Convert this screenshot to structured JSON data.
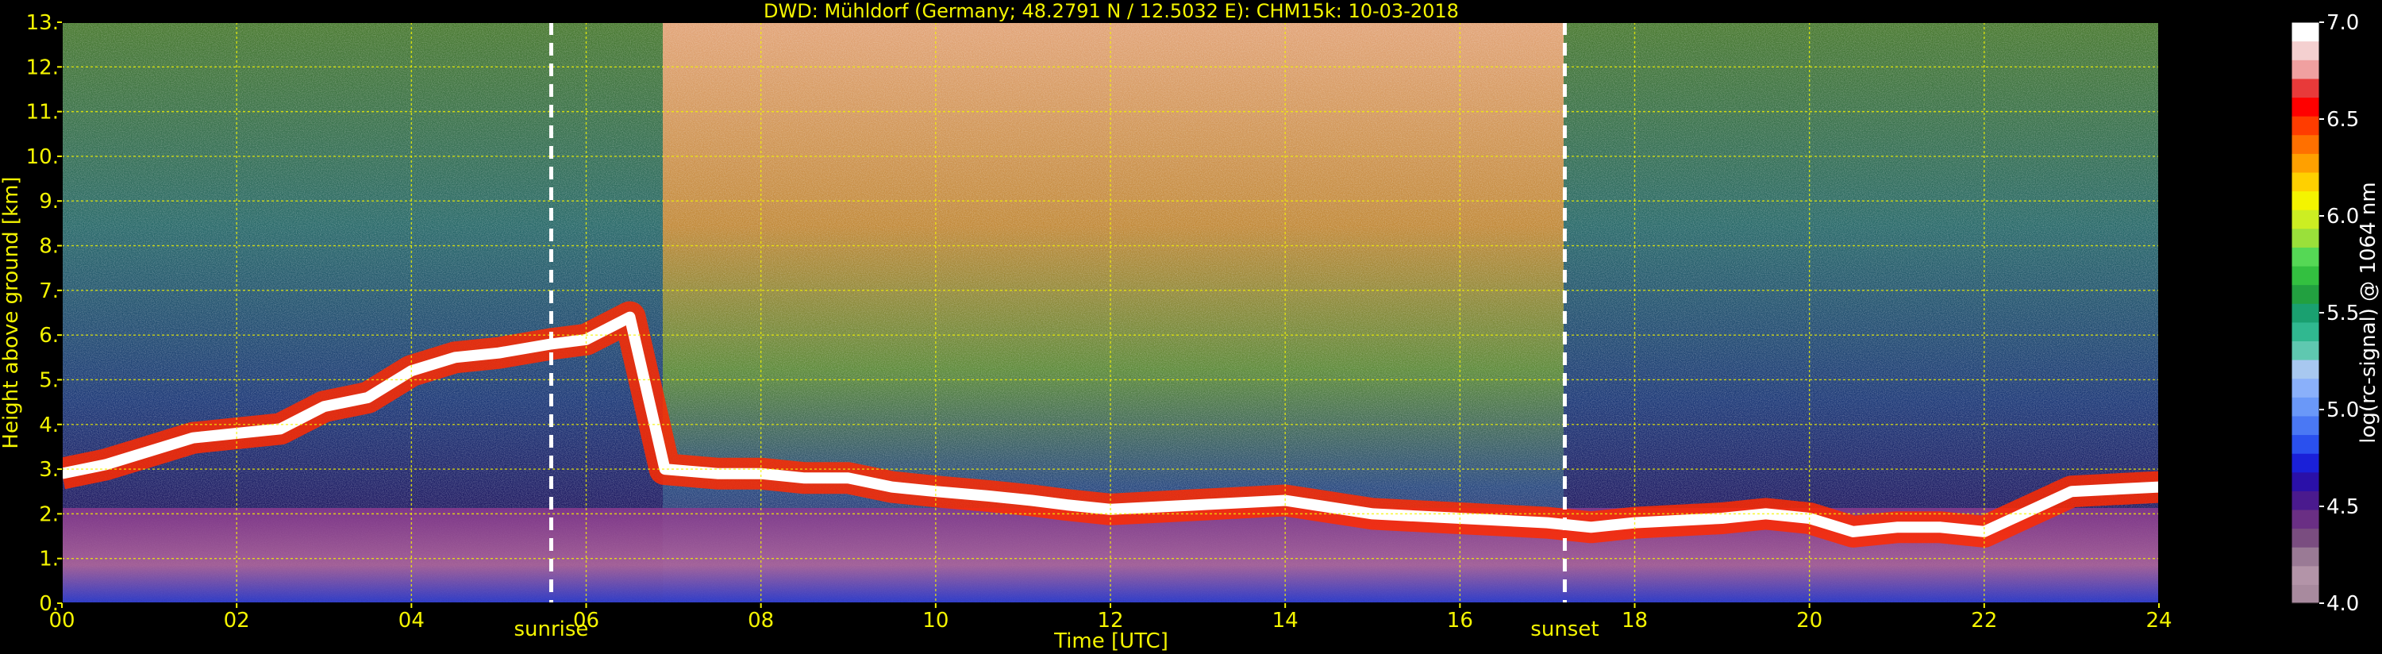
{
  "chart_data": {
    "type": "heatmap",
    "title": "DWD: Mühldorf (Germany; 48.2791 N / 12.5032 E):    CHM15k: 10-03-2018",
    "xlabel": "Time [UTC]",
    "ylabel": "Height above ground [km]",
    "xlim": [
      0,
      24
    ],
    "ylim": [
      0,
      13
    ],
    "x_ticks": [
      "00",
      "02",
      "04",
      "06",
      "08",
      "10",
      "12",
      "14",
      "16",
      "18",
      "20",
      "22",
      "24"
    ],
    "y_ticks": [
      "0.",
      "1.",
      "2.",
      "3.",
      "4.",
      "5.",
      "6.",
      "7.",
      "8.",
      "9.",
      "10.",
      "11.",
      "12.",
      "13."
    ],
    "grid": true,
    "annotations": [
      {
        "label": "sunrise",
        "x": 5.6
      },
      {
        "label": "sunset",
        "x": 17.2
      }
    ],
    "colorbar": {
      "label": "log(rc-signal) @ 1064 nm",
      "range": [
        4.0,
        7.0
      ],
      "ticks": [
        "4.0",
        "4.5",
        "5.0",
        "5.5",
        "6.0",
        "6.5",
        "7.0"
      ],
      "colors": [
        "#a88a9e",
        "#b394a8",
        "#9a7a95",
        "#7a4d80",
        "#6a2f84",
        "#4a1a8e",
        "#2a10a8",
        "#1a20d8",
        "#2a50ee",
        "#4a78f4",
        "#6a98f8",
        "#8ab0fa",
        "#a8c8f0",
        "#5fc8b0",
        "#30b890",
        "#1aa070",
        "#22a040",
        "#33c040",
        "#55d855",
        "#9ae03a",
        "#ccee22",
        "#f4f400",
        "#ffd000",
        "#ffa000",
        "#ff7000",
        "#ff3c00",
        "#ff0000",
        "#e83a3a",
        "#f0a0a0",
        "#f4d0d0",
        "#ffffff"
      ]
    },
    "layers": [
      {
        "name": "cloud base",
        "points": [
          [
            0,
            2.9
          ],
          [
            0.5,
            3.1
          ],
          [
            1.0,
            3.4
          ],
          [
            1.5,
            3.7
          ],
          [
            2.0,
            3.8
          ],
          [
            2.5,
            3.9
          ],
          [
            3.0,
            4.4
          ],
          [
            3.5,
            4.6
          ],
          [
            4.0,
            5.2
          ],
          [
            4.5,
            5.5
          ],
          [
            5.0,
            5.6
          ],
          [
            5.6,
            5.8
          ],
          [
            6.0,
            5.9
          ],
          [
            6.5,
            6.4
          ],
          [
            6.9,
            3.0
          ],
          [
            7.5,
            2.9
          ],
          [
            8.0,
            2.9
          ],
          [
            8.5,
            2.8
          ],
          [
            9.0,
            2.8
          ],
          [
            9.5,
            2.6
          ],
          [
            10.0,
            2.5
          ],
          [
            10.6,
            2.4
          ],
          [
            11.1,
            2.3
          ],
          [
            11.5,
            2.2
          ],
          [
            12.0,
            2.1
          ],
          [
            13.0,
            2.2
          ],
          [
            14.0,
            2.3
          ],
          [
            15.0,
            2.0
          ],
          [
            16.0,
            1.9
          ],
          [
            17.0,
            1.8
          ],
          [
            17.5,
            1.7
          ],
          [
            18.0,
            1.8
          ],
          [
            19.0,
            1.9
          ],
          [
            19.5,
            2.0
          ],
          [
            20.0,
            1.9
          ],
          [
            20.5,
            1.6
          ],
          [
            21.0,
            1.7
          ],
          [
            21.5,
            1.7
          ],
          [
            22.0,
            1.6
          ],
          [
            23.0,
            2.5
          ],
          [
            24.0,
            2.6
          ]
        ]
      }
    ]
  }
}
